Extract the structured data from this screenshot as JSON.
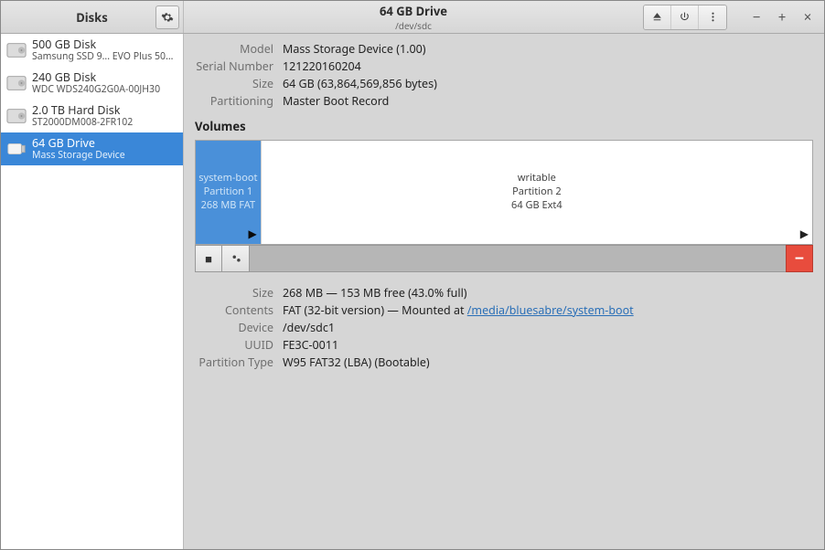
{
  "header": {
    "left_title": "Disks",
    "drive_title": "64 GB Drive",
    "drive_sub": "/dev/sdc"
  },
  "sidebar": {
    "items": [
      {
        "title": "500 GB Disk",
        "sub": "Samsung SSD 9... EVO Plus 500GB",
        "type": "hdd",
        "selected": false
      },
      {
        "title": "240 GB Disk",
        "sub": "WDC WDS240G2G0A-00JH30",
        "type": "hdd",
        "selected": false
      },
      {
        "title": "2.0 TB Hard Disk",
        "sub": "ST2000DM008-2FR102",
        "type": "hdd",
        "selected": false
      },
      {
        "title": "64 GB Drive",
        "sub": "Mass Storage Device",
        "type": "usb",
        "selected": true
      }
    ]
  },
  "drive_info": {
    "model_label": "Model",
    "model": "Mass Storage Device (1.00)",
    "serial_label": "Serial Number",
    "serial": "121220160204",
    "size_label": "Size",
    "size": "64 GB (63,864,569,856 bytes)",
    "partitioning_label": "Partitioning",
    "partitioning": "Master Boot Record"
  },
  "volumes": {
    "label": "Volumes",
    "partitions": [
      {
        "name": "system-boot",
        "line2": "Partition 1",
        "line3": "268 MB FAT",
        "width_pct": 10.5,
        "selected": true,
        "mounted": true
      },
      {
        "name": "writable",
        "line2": "Partition 2",
        "line3": "64 GB Ext4",
        "width_pct": 89.5,
        "selected": false,
        "mounted": true
      }
    ]
  },
  "partition_details": {
    "size_label": "Size",
    "size": "268 MB — 153 MB free (43.0% full)",
    "contents_label": "Contents",
    "contents_prefix": "FAT (32-bit version) — Mounted at ",
    "mount_path": "/media/bluesabre/system-boot",
    "device_label": "Device",
    "device": "/dev/sdc1",
    "uuid_label": "UUID",
    "uuid": "FE3C-0011",
    "ptype_label": "Partition Type",
    "ptype": "W95 FAT32 (LBA) (Bootable)"
  }
}
